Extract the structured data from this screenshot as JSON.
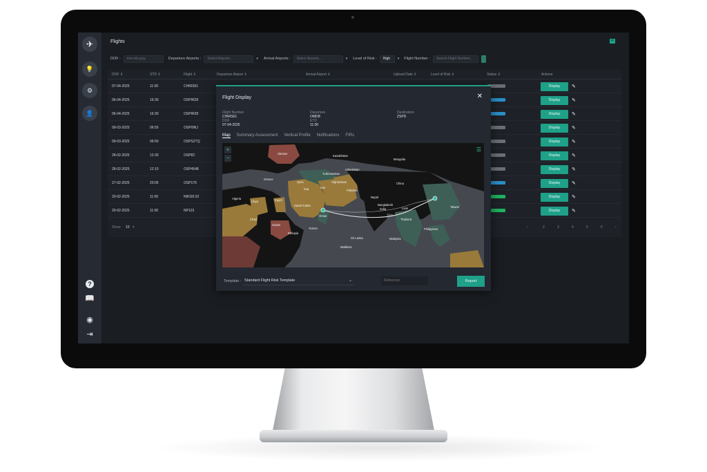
{
  "app": {
    "title": "Flights",
    "corner_badge_icon": "notification-icon"
  },
  "sidebar": {
    "logo_icon": "eagle-logo-icon",
    "items": [
      {
        "icon": "lightbulb-icon",
        "glyph": "💡"
      },
      {
        "icon": "settings-icon",
        "glyph": "⚙"
      },
      {
        "icon": "user-settings-icon",
        "glyph": "👤"
      }
    ],
    "bottom": [
      {
        "icon": "help-icon",
        "glyph": "?"
      },
      {
        "icon": "manual-book-icon",
        "glyph": "📖"
      },
      {
        "icon": "profile-icon",
        "glyph": "◉"
      },
      {
        "icon": "logout-icon",
        "glyph": "⇥"
      }
    ]
  },
  "filters": {
    "dof_label": "DOF :",
    "dof_placeholder": "mm-dd-yyyy",
    "dep_label": "Departure Airports :",
    "dep_placeholder": "Select Airports...",
    "arr_label": "Arrival Airports :",
    "arr_placeholder": "Select Airports...",
    "risk_label": "Level of Risk :",
    "risk_value": "High",
    "flight_label": "Flight Number :",
    "flight_placeholder": "Search Flight Number..."
  },
  "table": {
    "headers": [
      "DOF ⇕",
      "STD ⇕",
      "Flight ⇕",
      "Departure Airport ⇕",
      "Arrival Airport ⇕",
      "Upload Date ⇕",
      "Level of Risk ⇕",
      "Status ⇕",
      "Actions"
    ],
    "rows": [
      {
        "dof": "07-04-2025",
        "std": "11:00",
        "flight": "CHRIS01",
        "status_color": "#6b6f75"
      },
      {
        "dof": "06-04-2025",
        "std": "16:30",
        "flight": "OSPIR28",
        "status_color": "#2a8fc9"
      },
      {
        "dof": "06-04-2025",
        "std": "16:30",
        "flight": "OSPIR28",
        "status_color": "#2a8fc9"
      },
      {
        "dof": "09-03-2025",
        "std": "06:55",
        "flight": "OSPI9NJ",
        "status_color": "#6b6f75"
      },
      {
        "dof": "09-03-2025",
        "std": "06:50",
        "flight": "OSPS2TQ",
        "status_color": "#6b6f75"
      },
      {
        "dof": "28-02-2025",
        "std": "12:30",
        "flight": "OSP82",
        "status_color": "#6b6f75"
      },
      {
        "dof": "28-02-2025",
        "std": "12:10",
        "flight": "OSP4548",
        "status_color": "#6b6f75"
      },
      {
        "dof": "27-02-2025",
        "std": "20:05",
        "flight": "OSP176",
        "status_color": "#2a8fc9"
      },
      {
        "dof": "20-02-2025",
        "std": "11:00",
        "flight": "NIKI20.02",
        "status_color": "#1fb35f"
      },
      {
        "dof": "20-02-2025",
        "std": "11:00",
        "flight": "NP123",
        "status_color": "#1fb35f"
      }
    ],
    "display_label": "Display",
    "show_label": "Show",
    "show_value": "10",
    "pages": [
      "‹",
      "2",
      "3",
      "4",
      "5",
      "6",
      "›"
    ]
  },
  "modal": {
    "title": "Flight Display",
    "flight_number_label": "Flight Number",
    "flight_number": "CHRIS01",
    "dof_label": "DOF",
    "dof": "07-04-2025",
    "departure_label": "Departure",
    "departure": "OMDB",
    "etd_label": "ETD",
    "etd": "11:00",
    "destination_label": "Destination",
    "destination": "ZSPD",
    "tabs": [
      "Map",
      "Summary Assessment",
      "Vertical Profile",
      "Notifications",
      "FIRs"
    ],
    "active_tab": 0,
    "map_labels": [
      {
        "name": "Ukraine"
      },
      {
        "name": "Kazakhstan"
      },
      {
        "name": "Mongolia"
      },
      {
        "name": "Turkmenistan"
      },
      {
        "name": "Uzbekistan"
      },
      {
        "name": "Iran"
      },
      {
        "name": "Afghanistan"
      },
      {
        "name": "Pakistan"
      },
      {
        "name": "Iraq"
      },
      {
        "name": "China"
      },
      {
        "name": "Egypt"
      },
      {
        "name": "Saudi Arabia"
      },
      {
        "name": "Oman"
      },
      {
        "name": "India"
      },
      {
        "name": "Nepal"
      },
      {
        "name": "Bangladesh"
      },
      {
        "name": "Sudan"
      },
      {
        "name": "Ethiopia"
      },
      {
        "name": "Sri Lanka"
      },
      {
        "name": "Maldives"
      },
      {
        "name": "Malaysia"
      },
      {
        "name": "Philippines"
      },
      {
        "name": "Thailand"
      },
      {
        "name": "Algeria"
      },
      {
        "name": "Libya"
      },
      {
        "name": "Chad"
      },
      {
        "name": "Yemen"
      },
      {
        "name": "Greece"
      },
      {
        "name": "Syria"
      },
      {
        "name": "Taiwan"
      },
      {
        "name": "Laos"
      }
    ],
    "template_label": "Template :",
    "template_value": "Standard Flight Risk Template",
    "reference_placeholder": "Reference",
    "report_label": "Report",
    "colors": {
      "danger": "#8a4a41",
      "caution": "#9a7a3a",
      "safe": "#3e5f56",
      "land": "#141414",
      "water": "#45494f"
    }
  }
}
